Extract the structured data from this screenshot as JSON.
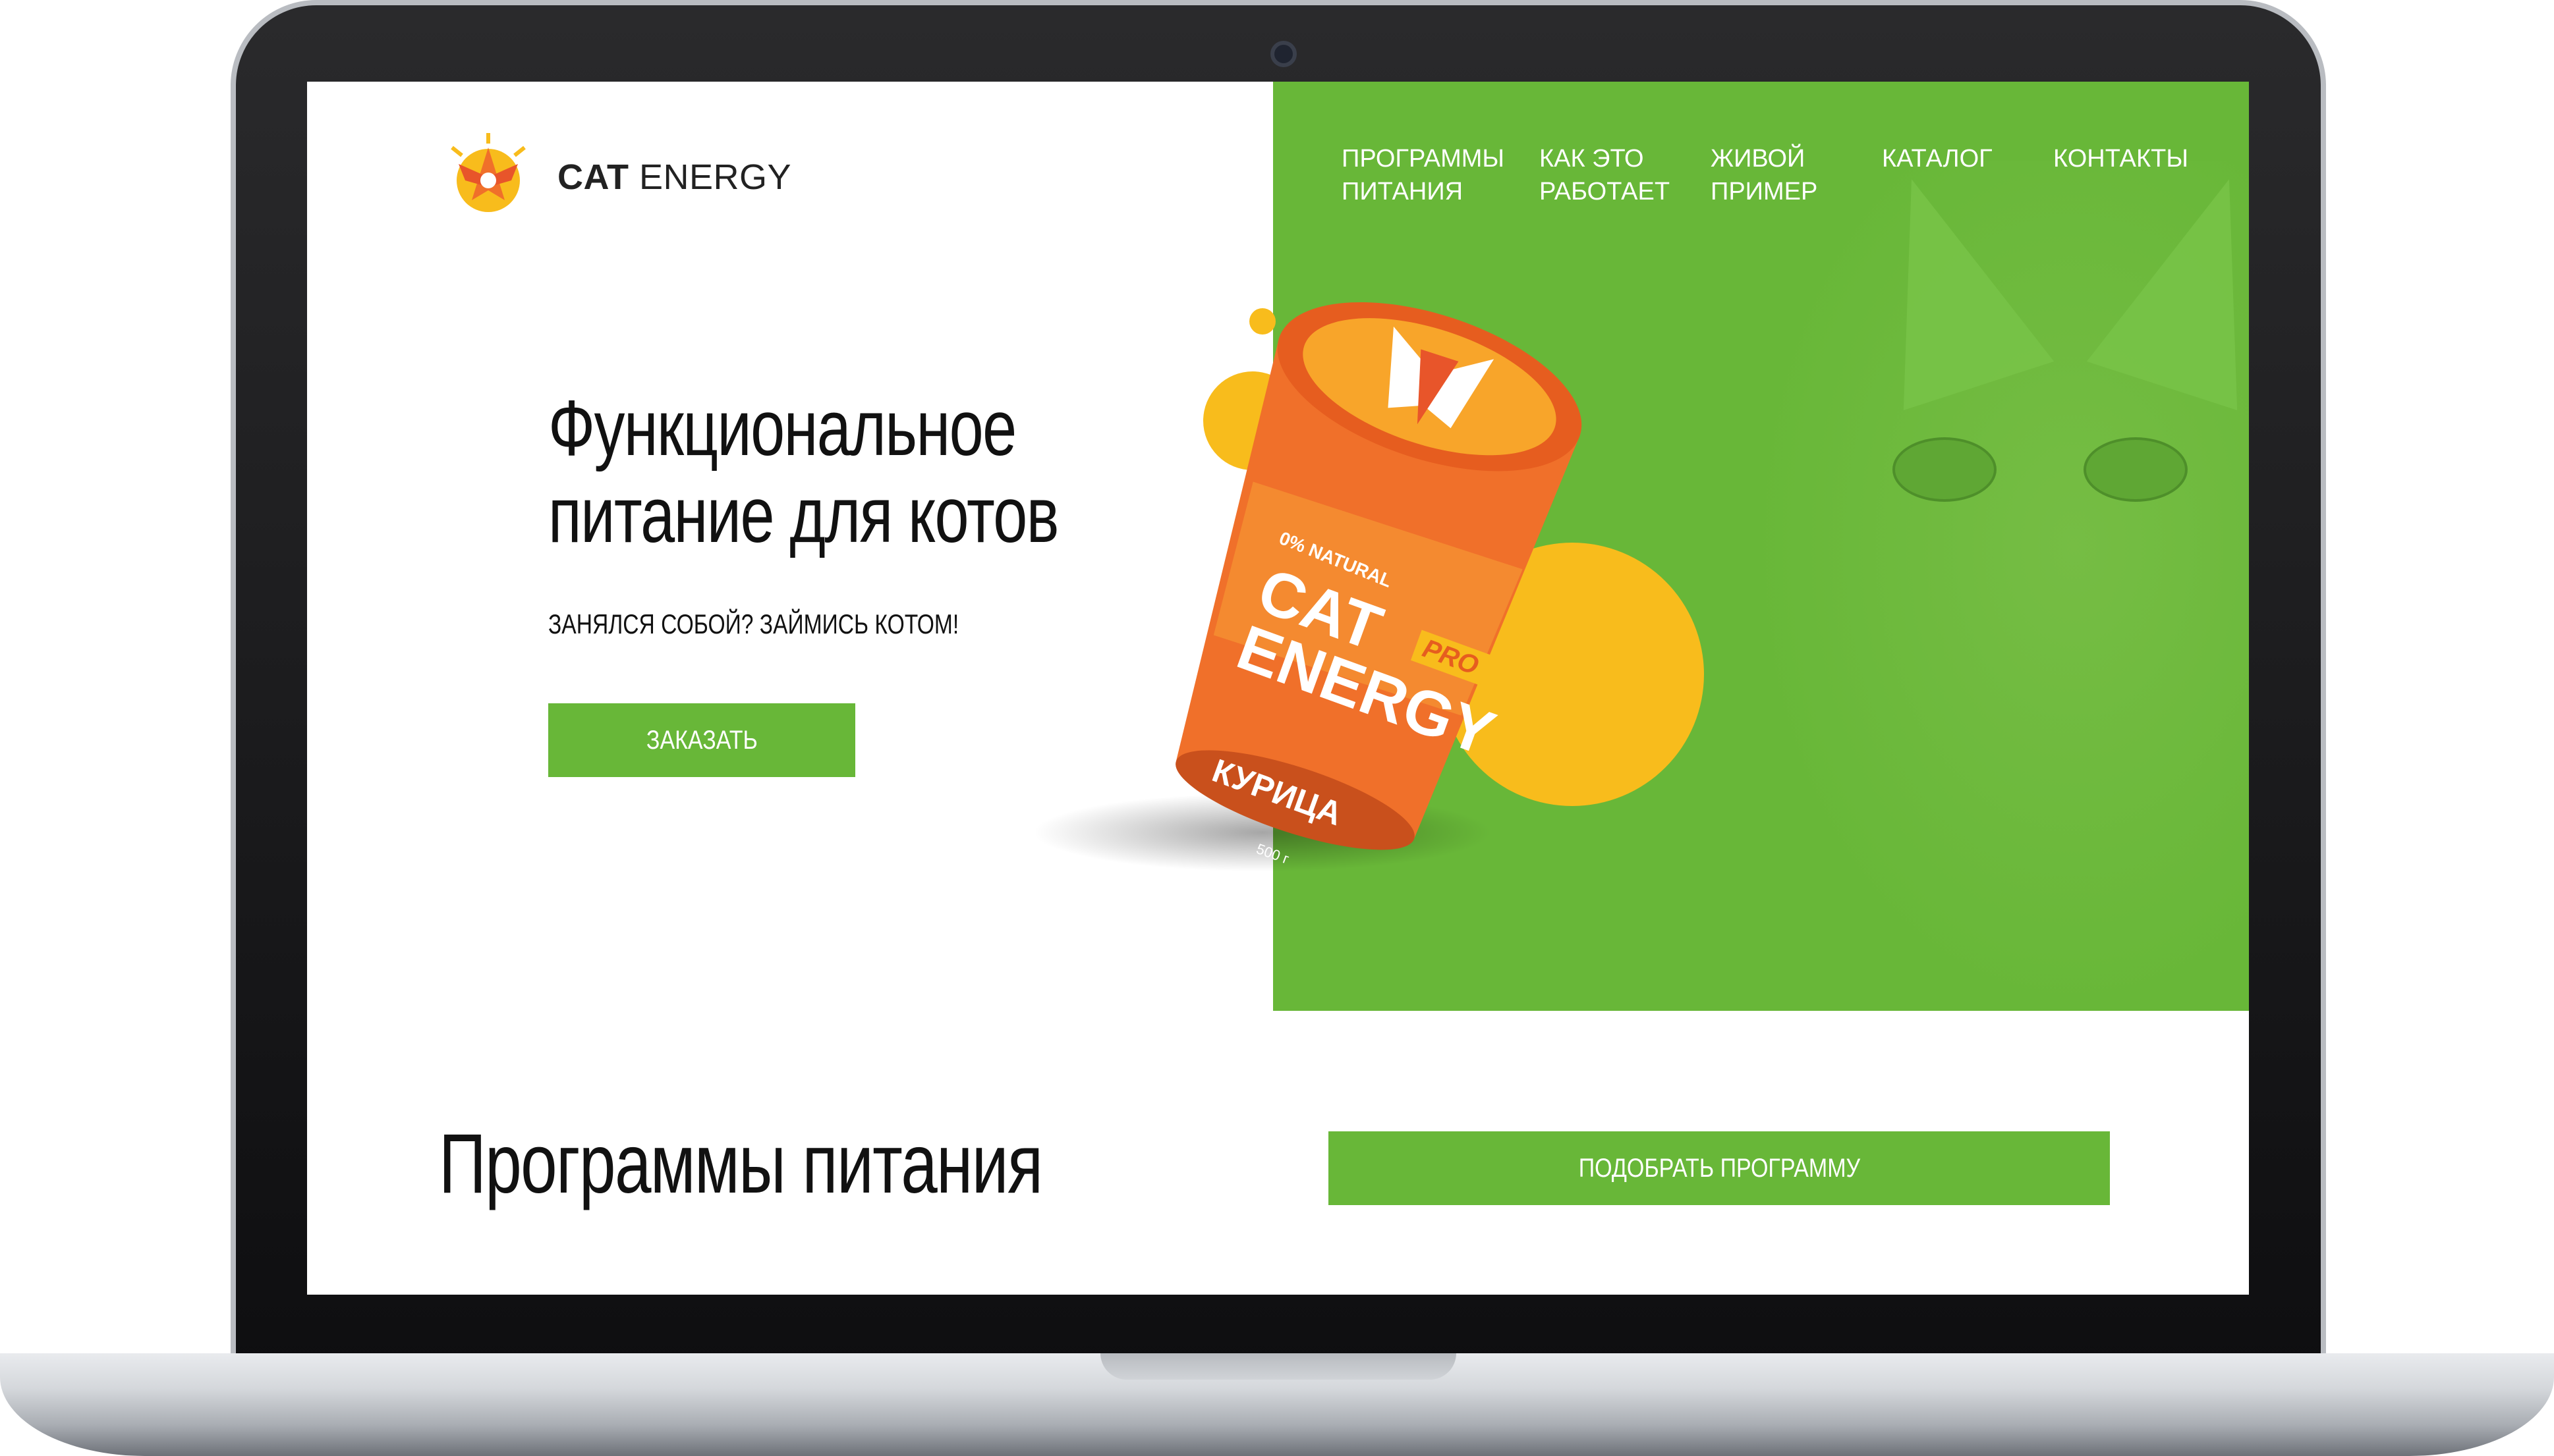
{
  "logo": {
    "brand_bold": "CAT",
    "brand_light": "ENERGY"
  },
  "nav": {
    "items": [
      {
        "line1": "ПРОГРАММЫ",
        "line2": "ПИТАНИЯ"
      },
      {
        "line1": "КАК ЭТО",
        "line2": "РАБОТАЕТ"
      },
      {
        "line1": "ЖИВОЙ",
        "line2": "ПРИМЕР"
      },
      {
        "line1": "КАТАЛОГ",
        "line2": ""
      },
      {
        "line1": "КОНТАКТЫ",
        "line2": ""
      }
    ]
  },
  "hero": {
    "title_line1": "Функциональное",
    "title_line2": "питание для котов",
    "tagline": "ЗАНЯЛСЯ СОБОЙ? ЗАЙМИСЬ КОТОМ!",
    "order_label": "ЗАКАЗАТЬ"
  },
  "product": {
    "natural": "0% NATURAL",
    "brand_line1": "CAT",
    "brand_line2": "ENERGY",
    "badge": "PRO",
    "flavor": "КУРИЦА",
    "weight": "500 г"
  },
  "programs": {
    "title": "Программы питания",
    "choose_label": "ПОДОБРАТЬ ПРОГРАММУ"
  },
  "colors": {
    "accent_green": "#68b738",
    "accent_yellow": "#f8bc1c",
    "accent_orange": "#f0702a"
  }
}
